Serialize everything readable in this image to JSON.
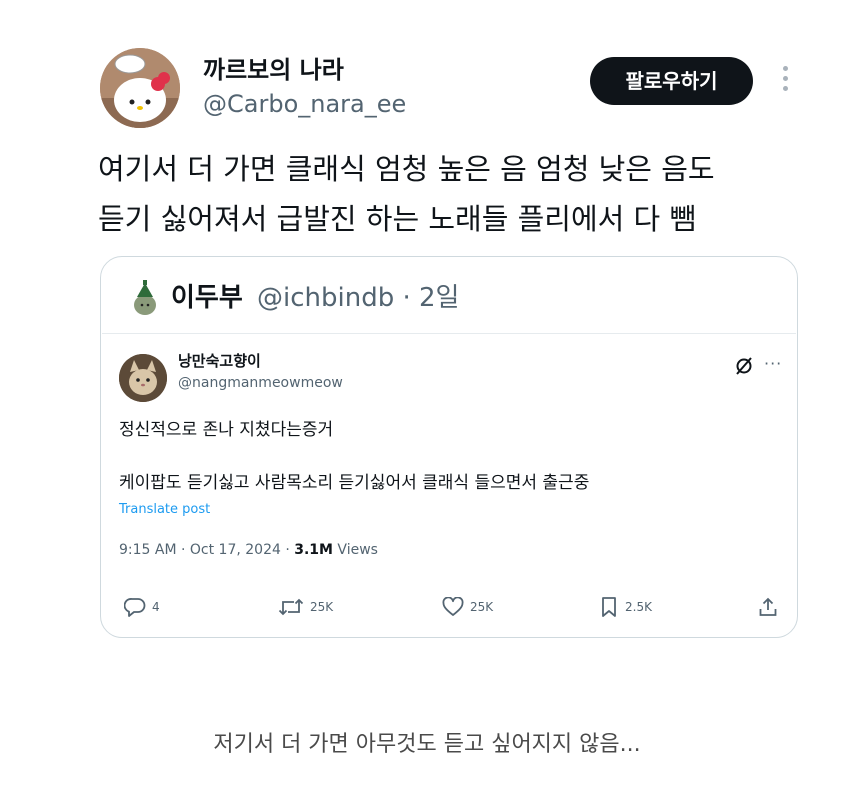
{
  "tweet": {
    "display_name": "까르보의 나라",
    "handle": "@Carbo_nara_ee",
    "follow_label": "팔로우하기",
    "text_line1": "여기서 더 가면 클래식 엄청 높은 음 엄청 낮은 음도",
    "text_line2": "듣기 싫어져서 급발진 하는 노래들 플리에서 다 뺌"
  },
  "quote": {
    "name": "이두부",
    "meta": "@ichbindb · 2일",
    "inner": {
      "name": "낭만숙고향이",
      "handle": "@nangmanmeowmeow",
      "text_line1": "정신적으로 존나 지쳤다는증거",
      "text_line2": "케이팝도 듣기싫고 사람목소리 듣기싫어서 클래식 들으면서 출근중",
      "translate_label": "Translate post",
      "timestamp": "9:15 AM · Oct 17, 2024 · ",
      "views_count": "3.1M",
      "views_label": " Views",
      "actions": {
        "replies": "4",
        "reposts": "25K",
        "likes": "25K",
        "bookmarks": "2.5K"
      }
    }
  },
  "footer": {
    "text": "저기서 더 가면 아무것도 듣고 싶어지지 않음..."
  },
  "icons": {
    "more": "more-vertical-icon",
    "grok": "grok-icon",
    "more_horizontal": "more-horizontal-icon",
    "reply": "reply-icon",
    "repost": "repost-icon",
    "like": "like-icon",
    "bookmark": "bookmark-icon",
    "share": "share-icon"
  },
  "colors": {
    "text": "#0f1419",
    "secondary": "#536471",
    "link": "#1d9bf0",
    "border": "#cfd9de",
    "button": "#0f1419"
  }
}
